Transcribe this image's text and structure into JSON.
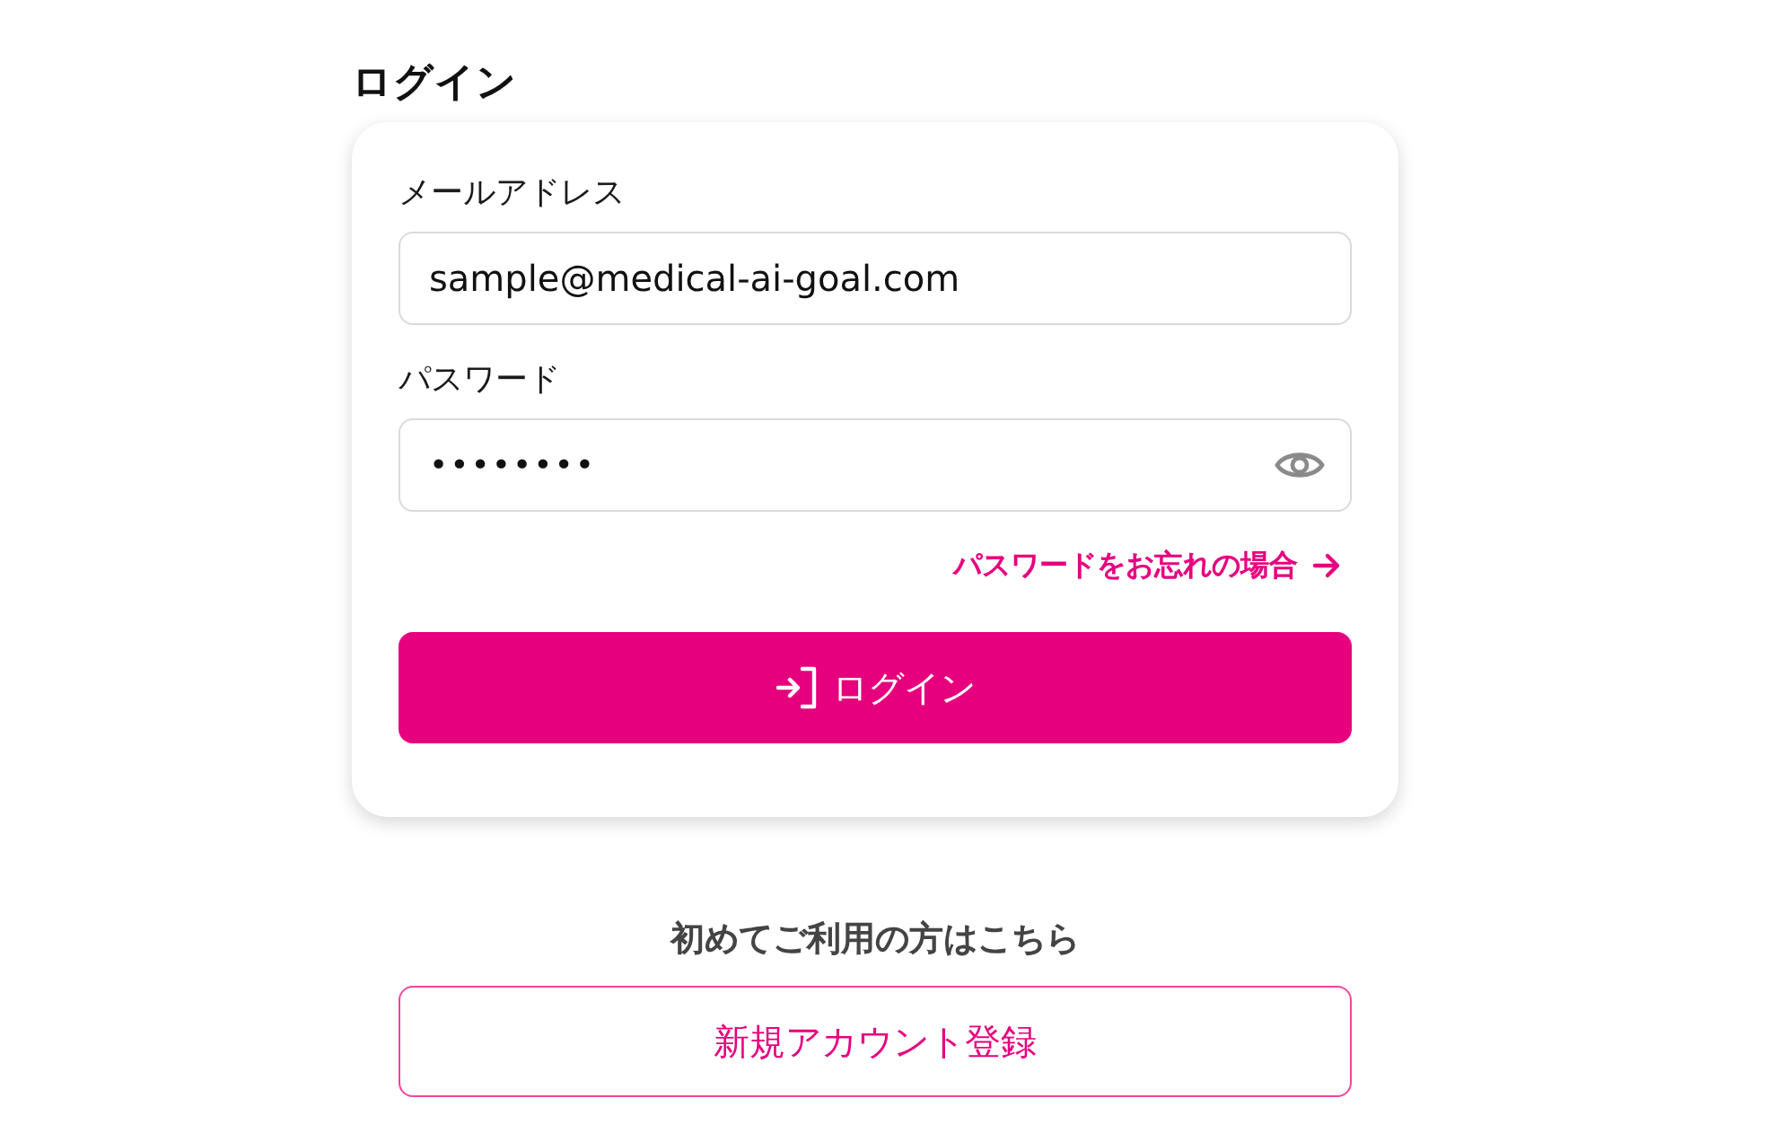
{
  "heading": "ログイン",
  "form": {
    "email": {
      "label": "メールアドレス",
      "value": "sample@medical-ai-goal.com"
    },
    "password": {
      "label": "パスワード",
      "value": "••••••••"
    },
    "forgot_link": "パスワードをお忘れの場合",
    "login_button": "ログイン"
  },
  "signup": {
    "prompt": "初めてご利用の方はこちら",
    "button": "新規アカウント登録"
  }
}
